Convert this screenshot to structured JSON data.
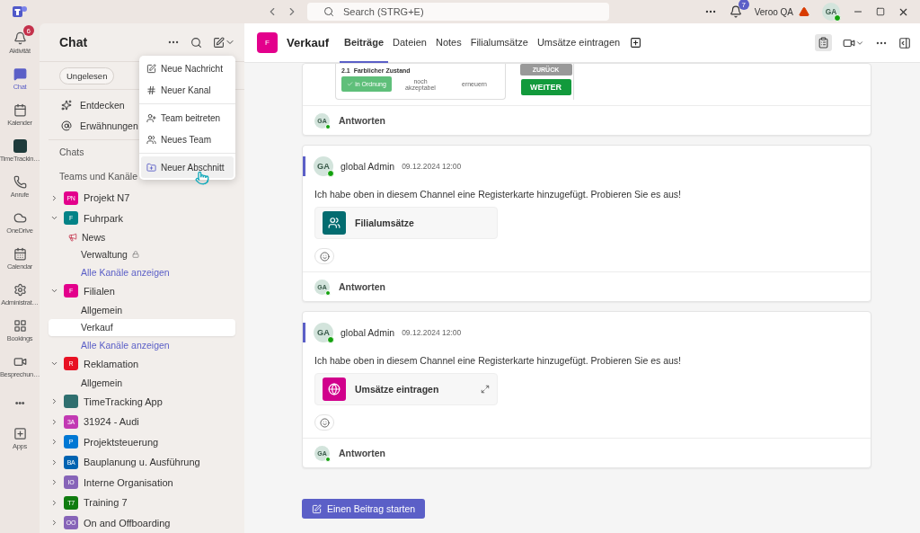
{
  "titlebar": {
    "search": {
      "placeholder": "Search (STRG+E)"
    },
    "notifications": "7",
    "org": "Veroo QA",
    "avatar": "GA"
  },
  "rail": [
    {
      "label": "Aktivität",
      "badge": "6",
      "selected": false
    },
    {
      "label": "Chat",
      "selected": true
    },
    {
      "label": "Kalender",
      "selected": false
    },
    {
      "label": "TimeTrackin…",
      "selected": false
    },
    {
      "label": "Anrufe",
      "selected": false
    },
    {
      "label": "OneDrive",
      "selected": false
    },
    {
      "label": "Calendar",
      "selected": false
    },
    {
      "label": "Administrat…",
      "selected": false
    },
    {
      "label": "Bookings",
      "selected": false
    },
    {
      "label": "Besprechun…",
      "selected": false
    },
    {
      "label": "•••",
      "selected": false
    },
    {
      "label": "Apps",
      "selected": false
    }
  ],
  "sidebar": {
    "title": "Chat",
    "filter": "Ungelesen",
    "nav": [
      "Entdecken",
      "Erwähnungen"
    ],
    "sections": [
      "Chats",
      "Teams und Kanäle"
    ],
    "teams": [
      {
        "name": "Projekt N7",
        "initials": "PN",
        "color": "#e3008c",
        "expanded": false
      },
      {
        "name": "Fuhrpark",
        "initials": "F",
        "color": "#038387",
        "expanded": true,
        "children": [
          {
            "kind": "announcement",
            "name": "News",
            "selected": false,
            "locked": false
          },
          {
            "kind": "channel",
            "name": "Verwaltung",
            "selected": false,
            "locked": true
          },
          {
            "kind": "link",
            "name": "Alle Kanäle anzeigen",
            "selected": false,
            "locked": false
          }
        ]
      },
      {
        "name": "Filialen",
        "initials": "F",
        "color": "#e3008c",
        "expanded": true,
        "children": [
          {
            "kind": "channel",
            "name": "Allgemein",
            "selected": false,
            "locked": false
          },
          {
            "kind": "channel",
            "name": "Verkauf",
            "selected": true,
            "locked": false
          },
          {
            "kind": "link",
            "name": "Alle Kanäle anzeigen",
            "selected": false,
            "locked": false
          }
        ]
      },
      {
        "name": "Reklamation",
        "initials": "R",
        "color": "#e81123",
        "expanded": true,
        "children": [
          {
            "kind": "channel",
            "name": "Allgemein",
            "selected": false,
            "locked": false
          }
        ]
      },
      {
        "name": "TimeTracking App",
        "color": "#2f6f6f",
        "expanded": false
      },
      {
        "name": "31924 - Audi",
        "initials": "3A",
        "color": "#c239b3",
        "expanded": false
      },
      {
        "name": "Projektsteuerung",
        "initials": "P",
        "color": "#0078d4",
        "expanded": false
      },
      {
        "name": "Bauplanung u. Ausführung",
        "initials": "BA",
        "color": "#0063b1",
        "expanded": false
      },
      {
        "name": "Interne Organisation",
        "initials": "IO",
        "color": "#8764b8",
        "expanded": false
      },
      {
        "name": "Training 7",
        "initials": "T7",
        "color": "#107c10",
        "expanded": false
      },
      {
        "name": "On and Offboarding",
        "initials": "OO",
        "color": "#8764b8",
        "expanded": false
      }
    ]
  },
  "menu": {
    "groups": [
      [
        {
          "label": "Neue Nachricht",
          "highlighted": false
        },
        {
          "label": "Neuer Kanal",
          "highlighted": false
        }
      ],
      [
        {
          "label": "Team beitreten",
          "highlighted": false
        },
        {
          "label": "Neues Team",
          "highlighted": false
        }
      ],
      [
        {
          "label": "Neuer Abschnitt",
          "highlighted": true
        }
      ]
    ]
  },
  "channel": {
    "initial": "F",
    "name": "Verkauf",
    "tabs": [
      {
        "label": "Beiträge",
        "selected": true
      },
      {
        "label": "Dateien",
        "selected": false
      },
      {
        "label": "Notes",
        "selected": false
      },
      {
        "label": "Filialumsätze",
        "selected": false
      },
      {
        "label": "Umsätze eintragen",
        "selected": false
      }
    ]
  },
  "preview": {
    "number": "2.1",
    "label": "Farblicher Zustand",
    "options": [
      {
        "label": "in Ordnung",
        "selected": true
      },
      {
        "label": "noch\nakzeptabel",
        "selected": false
      },
      {
        "label": "erneuern",
        "selected": false
      }
    ],
    "back": "ZURÜCK",
    "next": "WEITER",
    "reply": {
      "initials": "GA",
      "label": "Antworten"
    }
  },
  "posts": [
    {
      "author": "global Admin",
      "initials": "GA",
      "time": "09.12.2024 12:00",
      "text": "Ich habe oben in diesem Channel eine Registerkarte hinzugefügt. Probieren Sie es aus!",
      "attachment": {
        "kind": "sharepoint",
        "title": "Filialumsätze"
      },
      "reply": {
        "initials": "GA",
        "label": "Antworten"
      }
    },
    {
      "author": "global Admin",
      "initials": "GA",
      "time": "09.12.2024 12:00",
      "text": "Ich habe oben in diesem Channel eine Registerkarte hinzugefügt. Probieren Sie es aus!",
      "attachment": {
        "kind": "web",
        "title": "Umsätze eintragen"
      },
      "reply": {
        "initials": "GA",
        "label": "Antworten"
      }
    }
  ],
  "new_post": "Einen Beitrag starten"
}
